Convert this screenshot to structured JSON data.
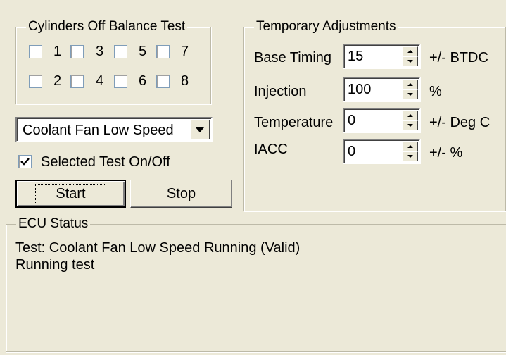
{
  "balance_test": {
    "title": "Cylinders Off Balance Test",
    "cylinders": [
      {
        "label": "1",
        "checked": false
      },
      {
        "label": "3",
        "checked": false
      },
      {
        "label": "5",
        "checked": false
      },
      {
        "label": "7",
        "checked": false
      },
      {
        "label": "2",
        "checked": false
      },
      {
        "label": "4",
        "checked": false
      },
      {
        "label": "6",
        "checked": false
      },
      {
        "label": "8",
        "checked": false
      }
    ]
  },
  "test_select": {
    "value": "Coolant Fan Low Speed",
    "onoff_label": "Selected Test On/Off",
    "onoff_checked": true
  },
  "buttons": {
    "start": "Start",
    "stop": "Stop"
  },
  "temp_adjust": {
    "title": "Temporary Adjustments",
    "rows": [
      {
        "label": "Base Timing",
        "value": "15",
        "unit": "+/- BTDC"
      },
      {
        "label": "Injection",
        "value": "100",
        "unit": "%"
      },
      {
        "label": "Temperature",
        "value": "0",
        "unit": "+/- Deg C"
      },
      {
        "label": "IACC",
        "value": "0",
        "unit": "+/- %"
      }
    ]
  },
  "ecu_status": {
    "title": "ECU Status",
    "lines": [
      "Test: Coolant Fan Low Speed Running (Valid)",
      "Running test"
    ]
  }
}
